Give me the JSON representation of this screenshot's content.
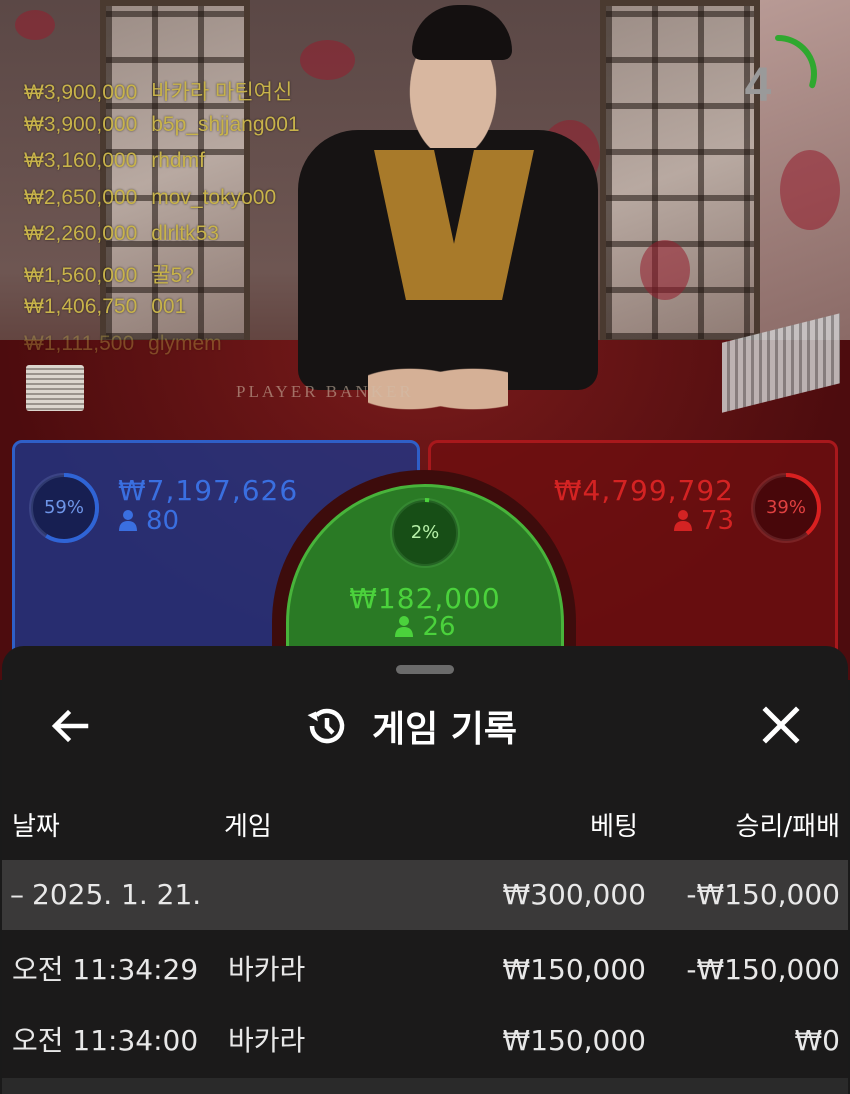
{
  "leaderboard": [
    {
      "amount": "₩3,900,000",
      "name": "바카라 마틴여신"
    },
    {
      "amount": "₩3,900,000",
      "name": "b5p_shjjang001"
    },
    {
      "amount": "₩3,160,000",
      "name": "rhdmf"
    },
    {
      "amount": "₩2,650,000",
      "name": "mov_tokyo00"
    },
    {
      "amount": "₩2,260,000",
      "name": "dlrltk53"
    },
    {
      "amount": "₩1,560,000",
      "name": "꿀5?"
    },
    {
      "amount": "₩1,406,750",
      "name": "001"
    },
    {
      "amount": "₩1,111,500",
      "name": "glymem"
    }
  ],
  "timer": {
    "value": "4",
    "fraction_remaining": 0.3,
    "color": "#2fa82f"
  },
  "table_text": "PLAYER        BANKER",
  "bets": {
    "player": {
      "percent": "59%",
      "percent_value": 0.59,
      "amount": "₩7,197,626",
      "players": "80",
      "color": "#2f64d6"
    },
    "tie": {
      "percent": "2%",
      "percent_value": 0.02,
      "amount": "₩182,000",
      "players": "26",
      "color": "#4bd23c"
    },
    "banker": {
      "percent": "39%",
      "percent_value": 0.39,
      "amount": "₩4,799,792",
      "players": "73",
      "color": "#d92020"
    }
  },
  "sheet": {
    "title": "게임 기록",
    "back_icon": "arrow-left-icon",
    "history_icon": "history-icon",
    "close_icon": "close-icon",
    "headers": {
      "date": "날짜",
      "game": "게임",
      "bet": "베팅",
      "result": "승리/패배"
    },
    "date_row": {
      "date": "2025. 1. 21.",
      "toggle": "–",
      "bet": "₩300,000",
      "result": "-₩150,000"
    },
    "rows": [
      {
        "time": "오전 11:34:29",
        "game": "바카라",
        "bet": "₩150,000",
        "result": "-₩150,000"
      },
      {
        "time": "오전 11:34:00",
        "game": "바카라",
        "bet": "₩150,000",
        "result": "₩0"
      }
    ]
  }
}
